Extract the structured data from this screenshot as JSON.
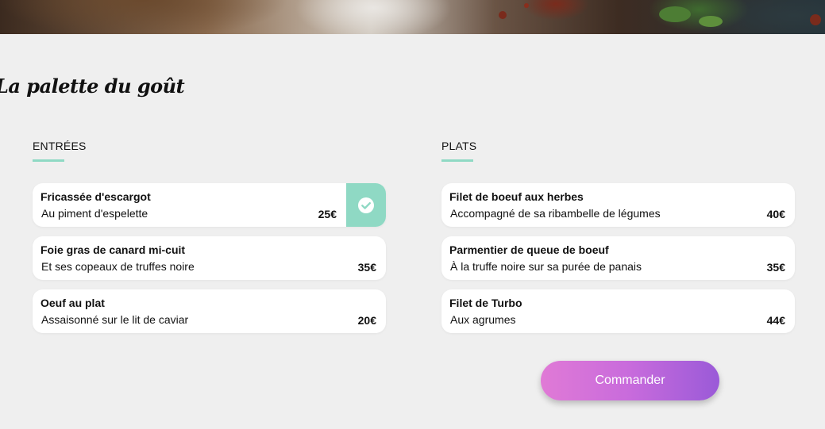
{
  "restaurant": {
    "title": "La palette du goût"
  },
  "sections": [
    {
      "heading": "ENTRÉES",
      "items": [
        {
          "name": "Fricassée d'escargot",
          "description": "Au piment d'espelette",
          "price": "25€",
          "selected": true
        },
        {
          "name": "Foie gras de canard mi-cuit",
          "description": "Et ses copeaux de truffes noire",
          "price": "35€",
          "selected": false
        },
        {
          "name": "Oeuf au plat",
          "description": "Assaisonné sur le lit de caviar",
          "price": "20€",
          "selected": false
        }
      ]
    },
    {
      "heading": "PLATS",
      "items": [
        {
          "name": "Filet de boeuf aux herbes",
          "description": "Accompagné de sa ribambelle de légumes",
          "price": "40€",
          "selected": false
        },
        {
          "name": "Parmentier de queue de boeuf",
          "description": "À la truffe noire sur sa purée de panais",
          "price": "35€",
          "selected": false
        },
        {
          "name": "Filet de Turbo",
          "description": "Aux agrumes",
          "price": "44€",
          "selected": false
        }
      ]
    }
  ],
  "order_button": {
    "label": "Commander"
  },
  "icons": {
    "selected_icon": "check-circle-icon"
  },
  "colors": {
    "accent": "#8fd9c4",
    "button_start": "#e07ad6",
    "button_end": "#9a5ad8",
    "background": "#efefef"
  }
}
